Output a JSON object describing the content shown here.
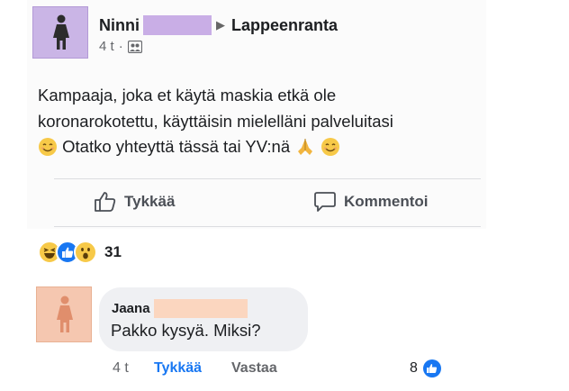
{
  "post": {
    "author": "Ninni",
    "group": "Lappeenranta",
    "time": "4 t",
    "separator": "·",
    "text_line1": "Kampaaja, joka et käytä maskia etkä ole",
    "text_line2": "koronarokotettu, käyttäisin mielelläni palveluitasi",
    "text_line3": "Otatko yhteyttä tässä tai YV:nä",
    "like_label": "Tykkää",
    "comment_label": "Kommentoi",
    "reaction_count": "31",
    "reactions": [
      "haha-emoji-icon",
      "like-icon",
      "wow-emoji-icon"
    ],
    "avatar_color": "#cab5e6"
  },
  "comment": {
    "author": "Jaana",
    "text": "Pakko kysyä. Miksi?",
    "time": "4 t",
    "like_label": "Tykkää",
    "reply_label": "Vastaa",
    "like_count": "8",
    "avatar_color": "#f5c7b0"
  },
  "colors": {
    "accent": "#1877f2",
    "redaction_purple": "#c9aee6",
    "redaction_peach": "#fbd6bf"
  }
}
